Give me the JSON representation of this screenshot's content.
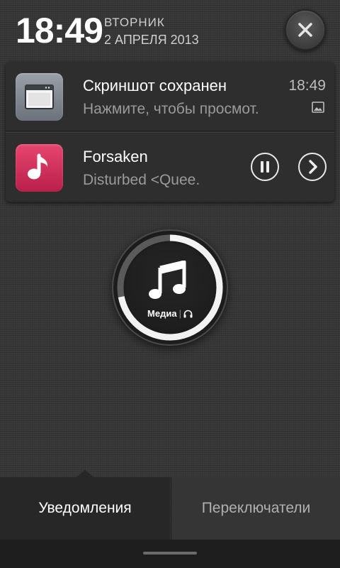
{
  "header": {
    "time": "18:49",
    "weekday": "ВТОРНИК",
    "date": "2 АПРЕЛЯ 2013",
    "close_icon": "close-icon"
  },
  "notifications": [
    {
      "icon": "browser-window-icon",
      "title": "Скриншот сохранен",
      "text": "Нажмите, чтобы просмот.",
      "time": "18:49",
      "badge_icon": "image-icon"
    },
    {
      "icon": "music-note-icon",
      "title": "Forsaken",
      "text": "Disturbed  <Quee.",
      "controls": [
        "pause-icon",
        "next-icon"
      ]
    }
  ],
  "media_dial": {
    "label": "Медиа",
    "icon": "music-note-icon",
    "headphones_icon": "headphones-icon",
    "level": 0.72
  },
  "tabs": [
    {
      "label": "Уведомления",
      "active": true
    },
    {
      "label": "Переключатели",
      "active": false
    }
  ],
  "colors": {
    "background": "#3a3a3a",
    "card": "#2e2e2e",
    "music_icon": "#d42f5c",
    "active_tab": "#272727"
  }
}
